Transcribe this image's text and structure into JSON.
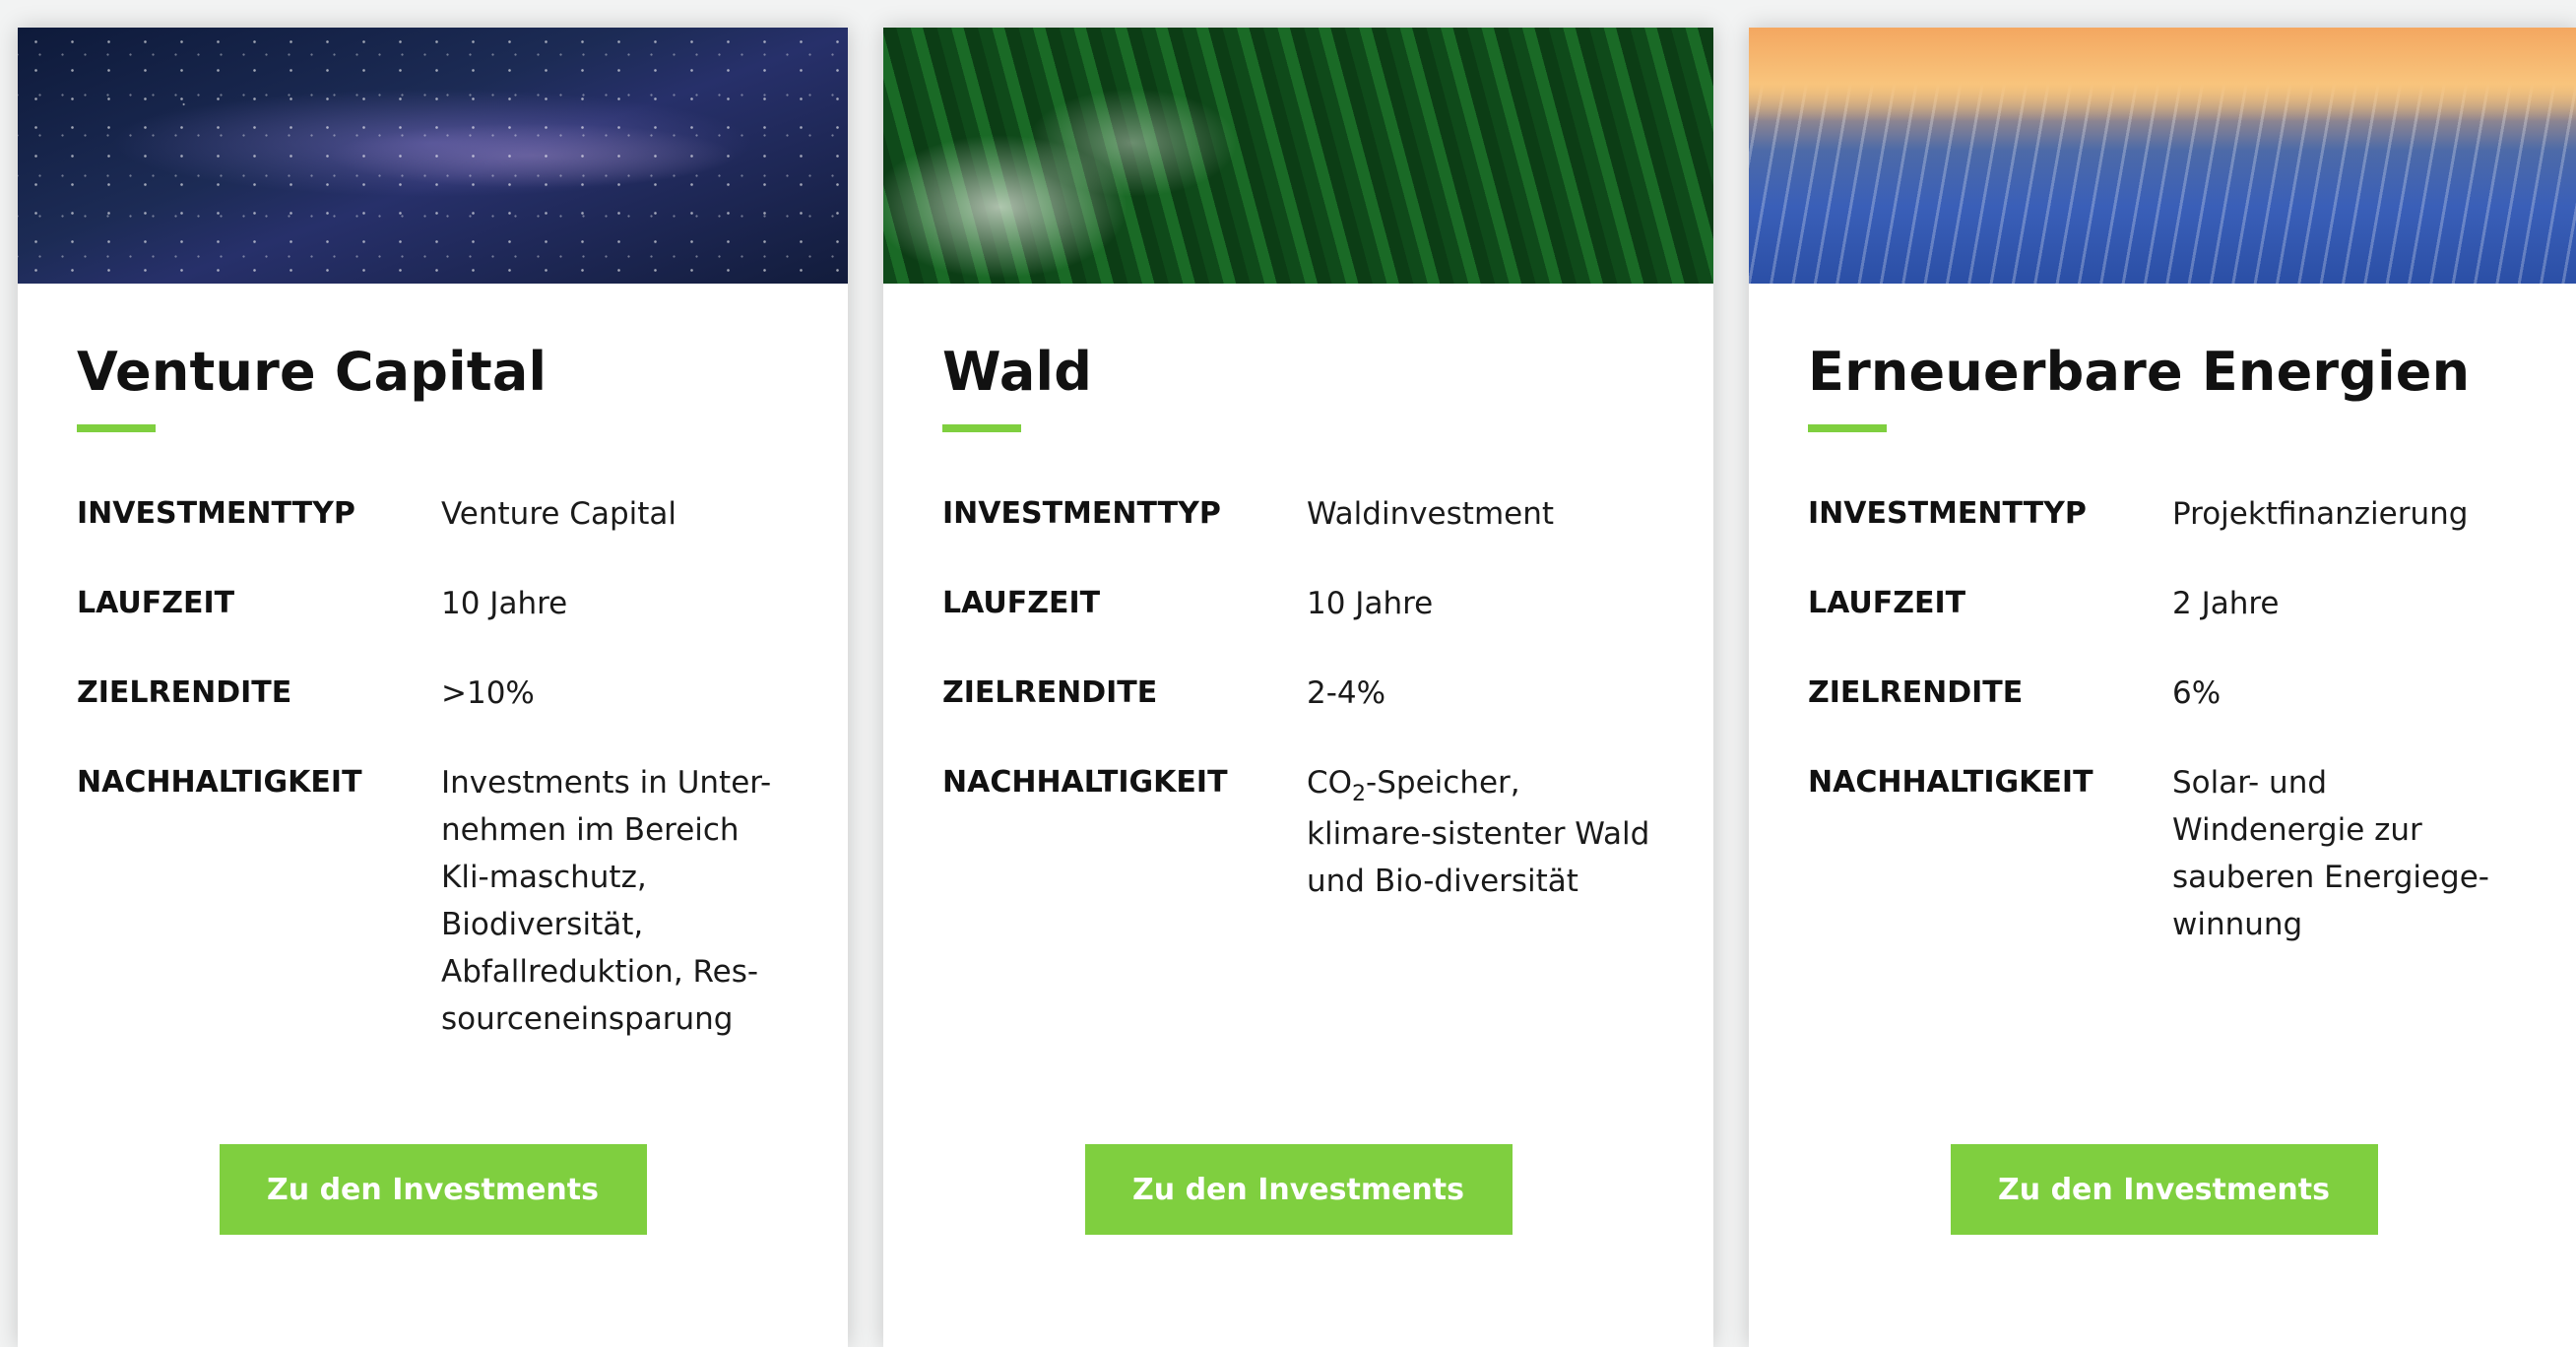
{
  "cards": [
    {
      "title": "Venture Capital",
      "labels": {
        "type": "INVESTMENTTYP",
        "term": "LAUFZEIT",
        "return": "ZIELRENDITE",
        "sustainability": "NACHHALTIGKEIT"
      },
      "values": {
        "type": "Venture Capital",
        "term": "10 Jahre",
        "return": ">10%",
        "sustainability": "Investments in Unter-nehmen im Bereich Kli-maschutz, Biodiversität, Abfallreduktion, Res-sourceneinsparung"
      },
      "button": "Zu den Investments"
    },
    {
      "title": "Wald",
      "labels": {
        "type": "INVESTMENTTYP",
        "term": "LAUFZEIT",
        "return": "ZIELRENDITE",
        "sustainability": "NACHHALTIGKEIT"
      },
      "values": {
        "type": "Waldinvestment",
        "term": "10 Jahre",
        "return": "2-4%",
        "sustainability_prefix": "CO",
        "sustainability_sub": "2",
        "sustainability_rest": "-Speicher, klimare-sistenter Wald und Bio-diversität"
      },
      "button": "Zu den Investments"
    },
    {
      "title": "Erneuerbare Energien",
      "labels": {
        "type": "INVESTMENTTYP",
        "term": "LAUFZEIT",
        "return": "ZIELRENDITE",
        "sustainability": "NACHHALTIGKEIT"
      },
      "values": {
        "type": "Projektfinanzierung",
        "term": "2 Jahre",
        "return": "6%",
        "sustainability": "Solar- und Windenergie zur sauberen Energiege-winnung"
      },
      "button": "Zu den Investments"
    }
  ],
  "colors": {
    "accent": "#7fcf3f",
    "text": "#111111",
    "background": "#f2f3f3"
  }
}
